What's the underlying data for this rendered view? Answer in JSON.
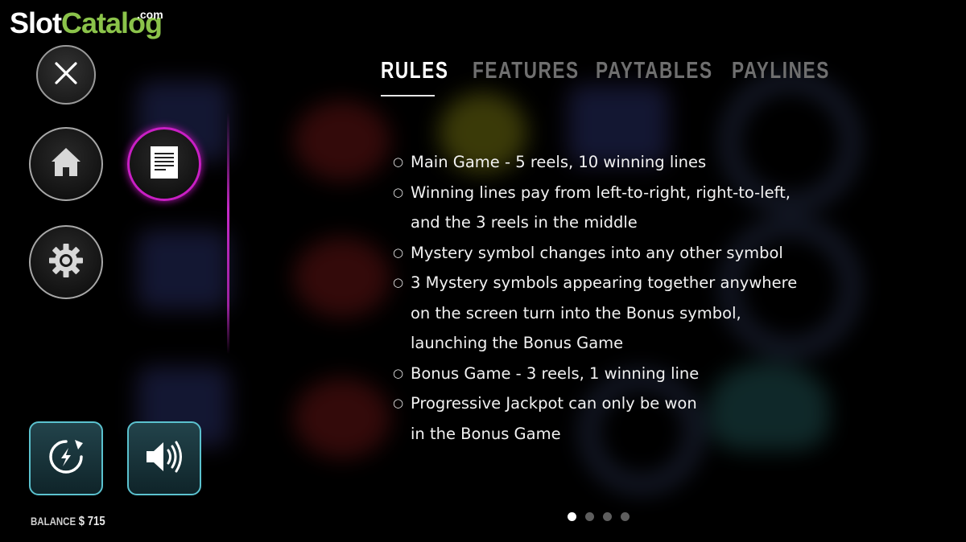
{
  "logo": {
    "slot": "Slot",
    "catalog": "Catalog",
    "dotcom": ".com"
  },
  "menu": {
    "close_icon": "close-icon",
    "home_icon": "home-icon",
    "rules_icon": "document-icon",
    "settings_icon": "gear-icon",
    "turbo_icon": "turbo-spin-icon",
    "sound_icon": "speaker-icon"
  },
  "balance": {
    "label": "BALANCE",
    "value": "$ 715"
  },
  "tabs": [
    {
      "label": "RULES",
      "active": true
    },
    {
      "label": "FEATURES",
      "active": false
    },
    {
      "label": "PAYTABLES",
      "active": false
    },
    {
      "label": "PAYLINES",
      "active": false
    }
  ],
  "rules": [
    {
      "lines": [
        "Main Game - 5 reels, 10 winning lines"
      ]
    },
    {
      "lines": [
        "Winning lines pay from left-to-right, right-to-left,",
        "and the 3 reels in the middle"
      ]
    },
    {
      "lines": [
        "Mystery symbol changes into any other symbol"
      ]
    },
    {
      "lines": [
        "3 Mystery symbols appearing together anywhere",
        "on the screen turn into the Bonus symbol,",
        "launching the Bonus Game"
      ]
    },
    {
      "lines": [
        "Bonus Game - 3 reels, 1 winning line"
      ]
    },
    {
      "lines": [
        "Progressive Jackpot can only be won",
        "in the Bonus Game"
      ]
    }
  ],
  "pager": {
    "total": 4,
    "current": 1
  },
  "colors": {
    "accent": "#c91fc4",
    "button_border": "#5bc2cf",
    "logo_green": "#8bc34a"
  }
}
